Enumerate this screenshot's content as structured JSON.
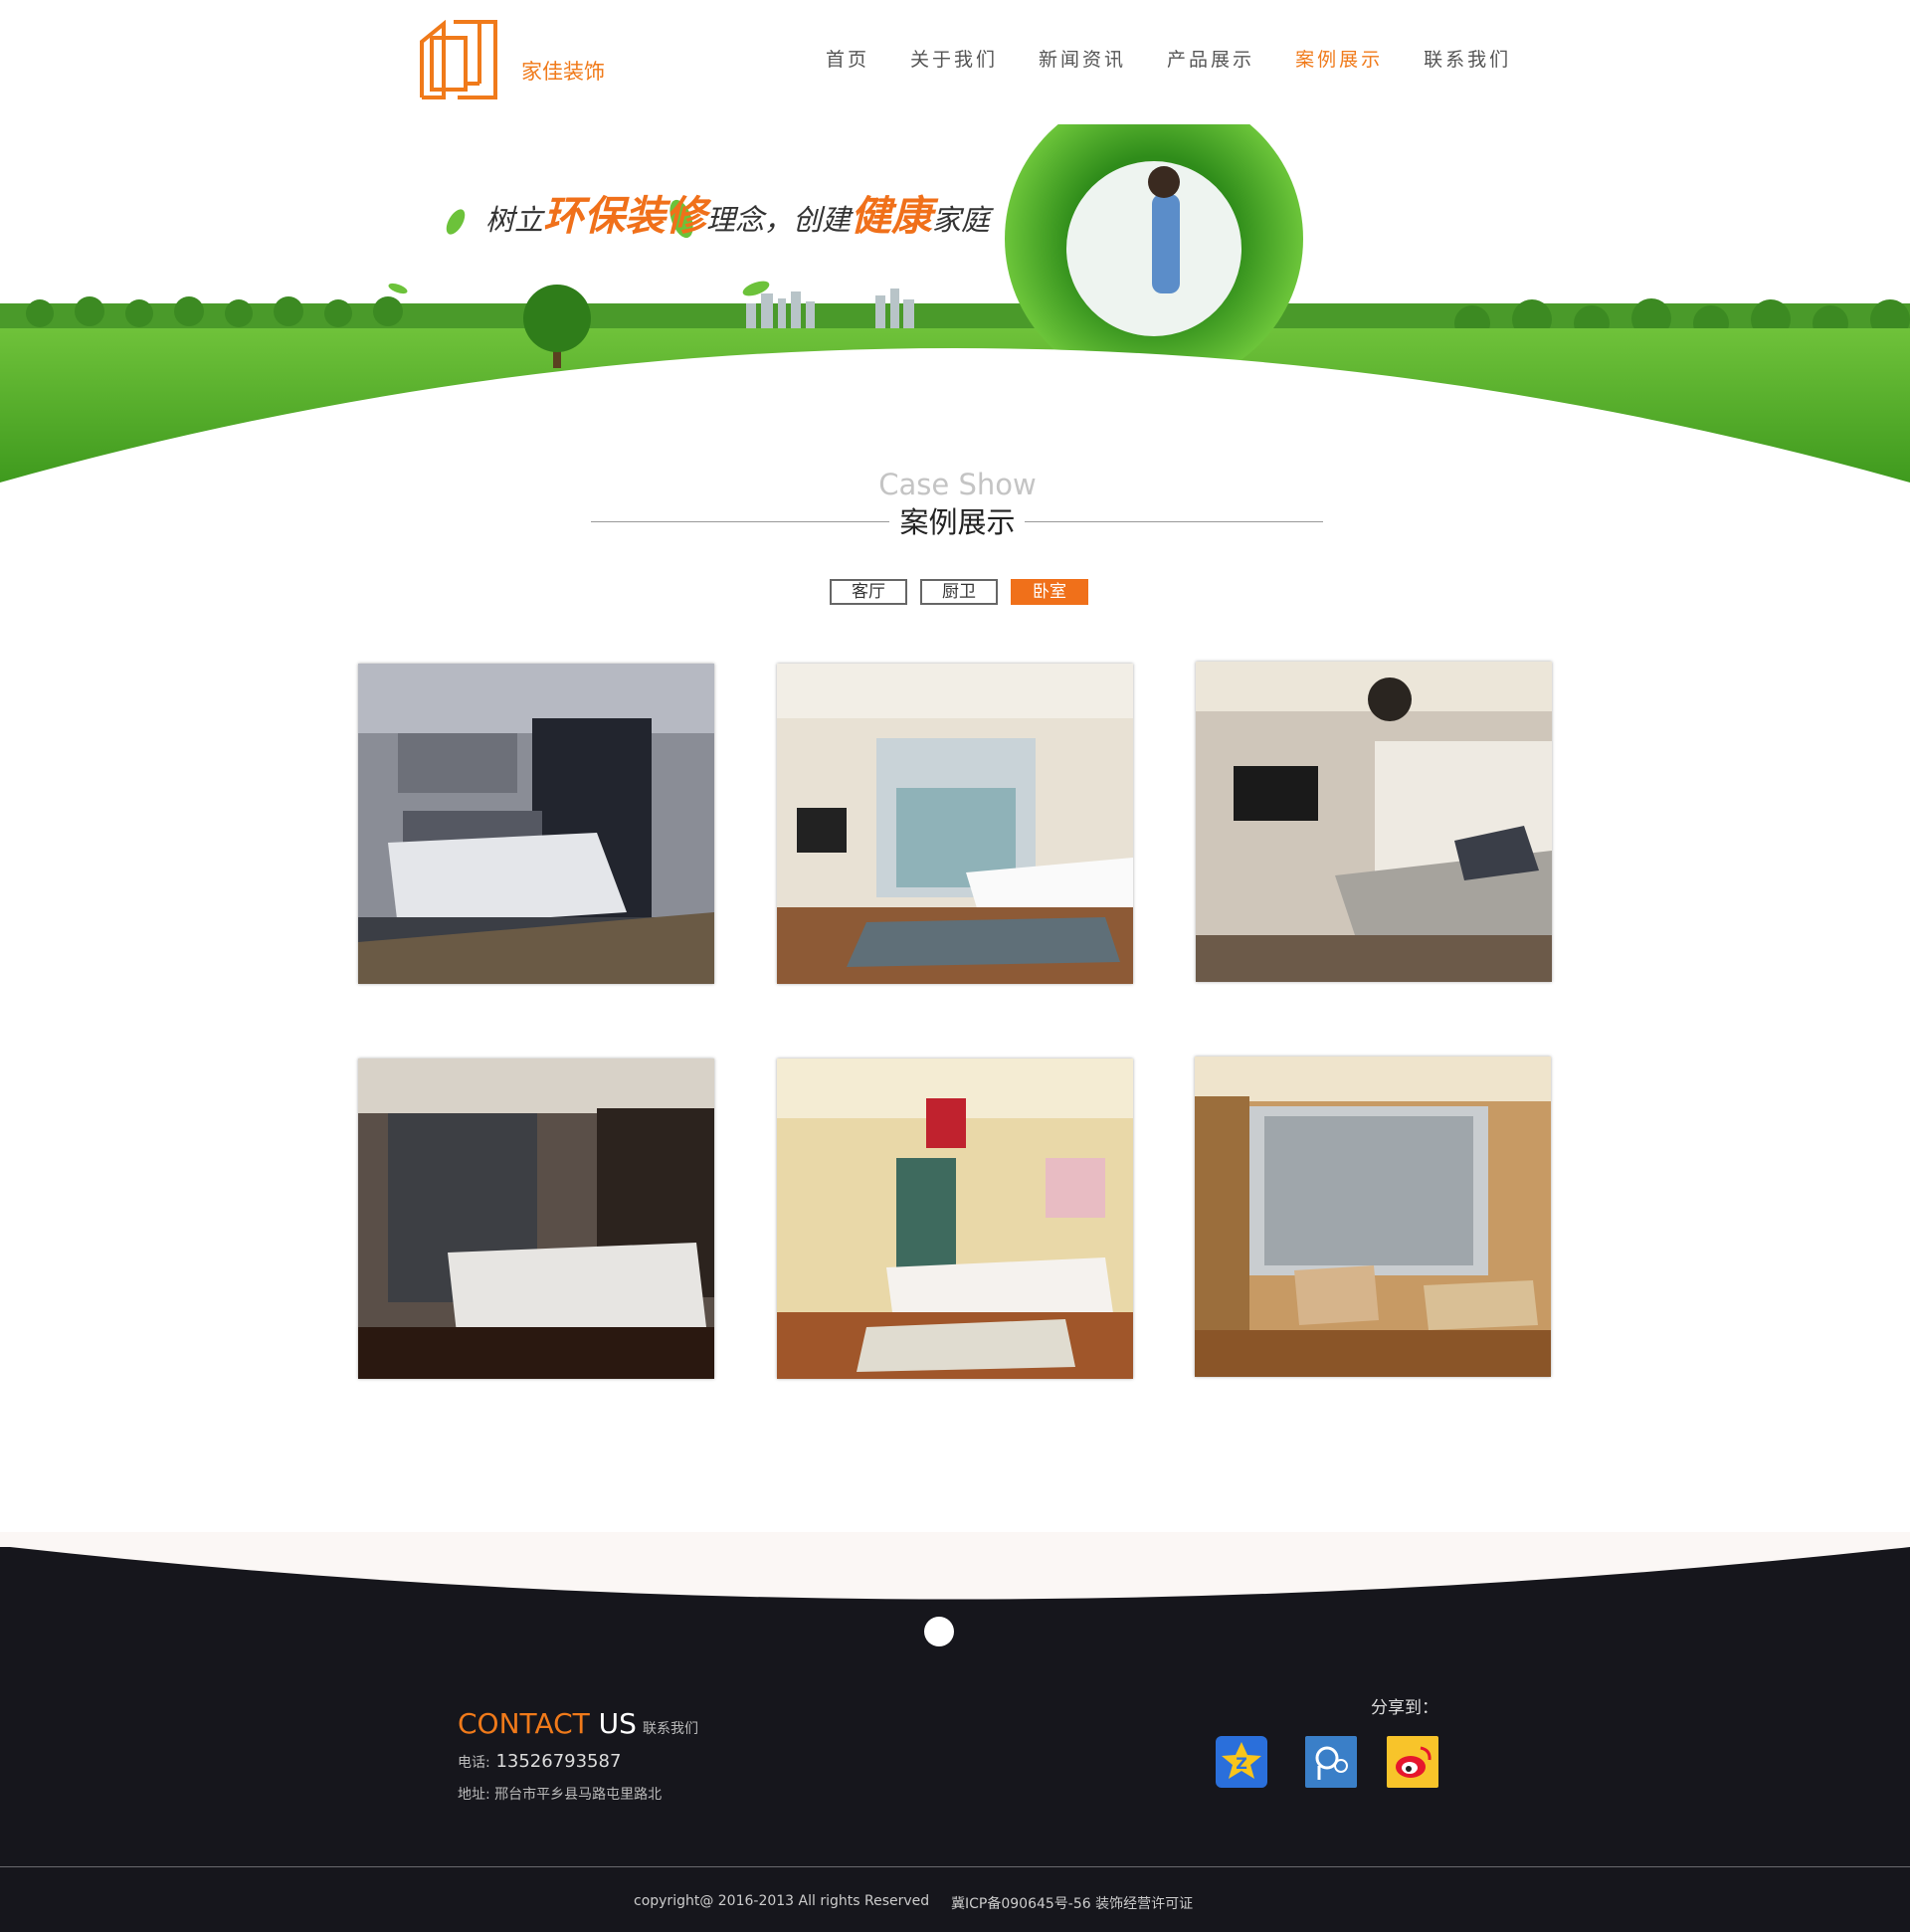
{
  "header": {
    "logo_text": "家佳装饰",
    "nav": [
      {
        "label": "首页"
      },
      {
        "label": "关于我们"
      },
      {
        "label": "新闻资讯"
      },
      {
        "label": "产品展示"
      },
      {
        "label": "案例展示",
        "active": true
      },
      {
        "label": "联系我们"
      }
    ]
  },
  "banner": {
    "slogan_parts": [
      "树立",
      "环保装修",
      "理念，",
      "创建",
      "健康",
      "家庭"
    ]
  },
  "section": {
    "title_en": "Case Show",
    "title_cn": "案例展示"
  },
  "tabs": [
    {
      "label": "客厅"
    },
    {
      "label": "厨卫"
    },
    {
      "label": "卧室",
      "active": true
    }
  ],
  "cases": [
    {
      "name": "bedroom-dark-modern"
    },
    {
      "name": "bedroom-bright-window"
    },
    {
      "name": "bedroom-silver-chandelier"
    },
    {
      "name": "bedroom-black-headboard"
    },
    {
      "name": "bedroom-warm-wood"
    },
    {
      "name": "bedroom-city-view"
    }
  ],
  "footer": {
    "contact_title_1": "CONTACT",
    "contact_title_2": " US",
    "contact_title_3": "联系我们",
    "phone_label": "电话:",
    "phone": " 13526793587",
    "address": "地址: 邢台市平乡县马路屯里路北",
    "share_label": "分享到：",
    "share_icons": [
      "qzone-icon",
      "tencent-weibo-icon",
      "sina-weibo-icon"
    ],
    "copyright": "copyright@ 2016-2013   All rights Reserved",
    "icp": "冀ICP备090645号-56 装饰经营许可证"
  },
  "colors": {
    "accent": "#f07a1a",
    "footer_bg": "#16161c",
    "grass": "#5cae2a"
  }
}
